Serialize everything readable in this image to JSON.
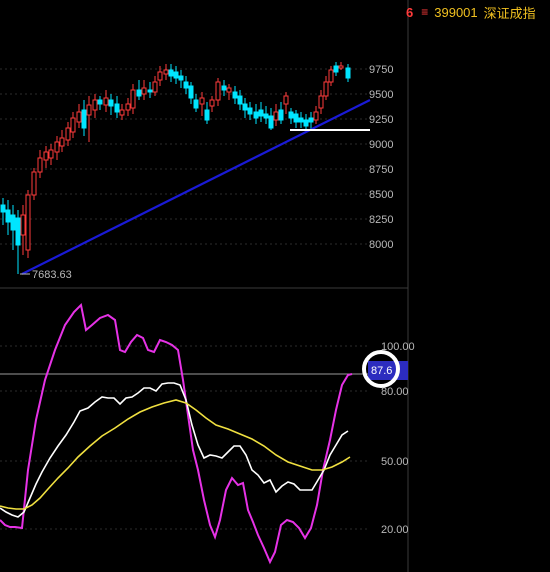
{
  "header": {
    "index_number": "6",
    "menu_glyph": "≡",
    "code": "399001",
    "name": "深证成指"
  },
  "price_panel": {
    "y_ticks": [
      "9750",
      "9500",
      "9250",
      "9000",
      "8750",
      "8500",
      "8250",
      "8000"
    ],
    "low_label": "7683.63"
  },
  "indicator_panel": {
    "y_ticks": [
      "100.00",
      "80.00",
      "50.00",
      "20.00"
    ],
    "current_value": "87.6"
  },
  "colors": {
    "up": "#ff3b3b",
    "down": "#00e5ff",
    "trendline": "#1a1ad6",
    "line_magenta": "#e632e6",
    "line_white": "#ffffff",
    "line_yellow": "#f0e040",
    "highlight_box": "#2c2cbf"
  }
}
